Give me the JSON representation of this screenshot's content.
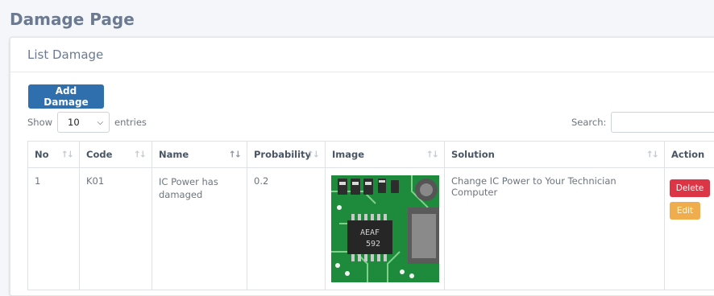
{
  "page": {
    "title": "Damage Page"
  },
  "card": {
    "title": "List Damage"
  },
  "toolbar": {
    "add_label": "Add Damage",
    "show_label": "Show",
    "entries_value": "10",
    "entries_label": "entries",
    "search_label": "Search:",
    "search_value": ""
  },
  "table": {
    "columns": [
      "No",
      "Code",
      "Name",
      "Probability",
      "Image",
      "Solution",
      "Action"
    ],
    "rows": [
      {
        "no": "1",
        "code": "K01",
        "name": "IC Power has damaged",
        "probability": "0.2",
        "image_chip_text_1": "AEAF",
        "image_chip_text_2": "592",
        "solution": "Change IC Power to Your Technician Computer",
        "delete_label": "Delete",
        "edit_label": "Edit"
      }
    ]
  },
  "colors": {
    "primary": "#2f6fae",
    "danger": "#dc3545",
    "warning": "#f0ad4e",
    "title": "#6c7a91"
  }
}
